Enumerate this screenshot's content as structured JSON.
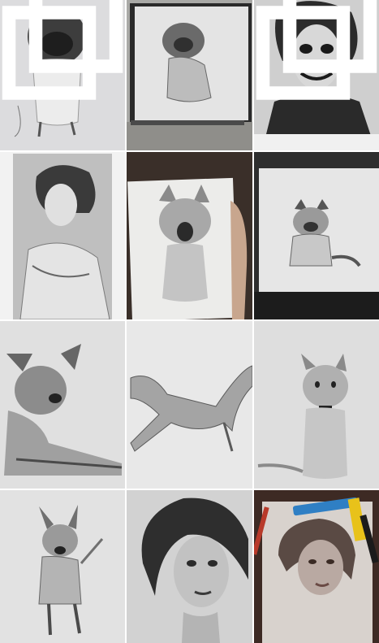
{
  "grid": {
    "tiles": [
      {
        "subject": "pug-sketch",
        "multi_image": true
      },
      {
        "subject": "framed-pug-drawing",
        "multi_image": false
      },
      {
        "subject": "joker-portrait",
        "multi_image": true
      },
      {
        "subject": "woman-portrait-drawing",
        "multi_image": false
      },
      {
        "subject": "yawning-cat-drawing",
        "multi_image": false
      },
      {
        "subject": "framed-bulldog-drawing",
        "multi_image": false
      },
      {
        "subject": "lying-dog-drawing",
        "multi_image": false
      },
      {
        "subject": "stretching-dog-drawing",
        "multi_image": false
      },
      {
        "subject": "kitten-drawing",
        "multi_image": false
      },
      {
        "subject": "running-dog-drawing",
        "multi_image": false
      },
      {
        "subject": "woman-face-drawing",
        "multi_image": false
      },
      {
        "subject": "woman-portrait-with-pencils",
        "multi_image": false
      }
    ]
  },
  "colors": {
    "paper": "#e6e6e6",
    "graphite_dark": "#2b2b2b",
    "graphite_mid": "#7a7a7a",
    "frame_dark": "#1f1f1f"
  }
}
